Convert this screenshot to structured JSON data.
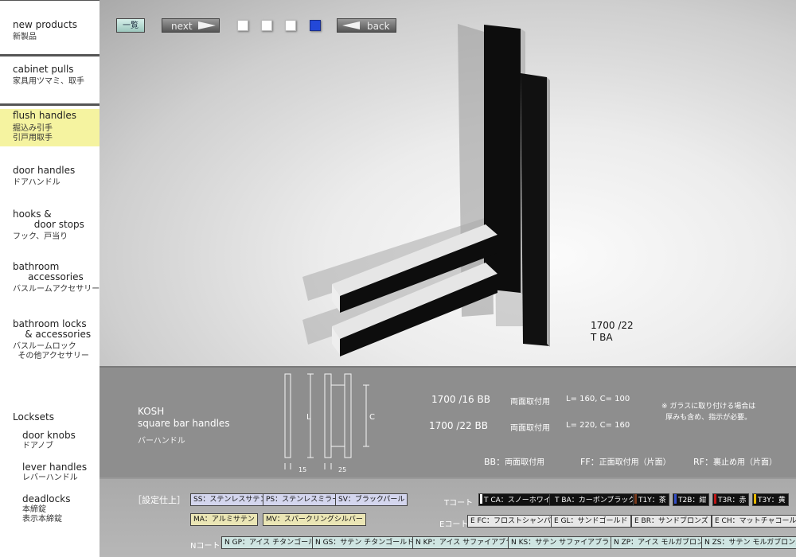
{
  "nav": [
    {
      "en": "new products",
      "jp": "新製品"
    },
    {
      "en": "cabinet pulls",
      "jp": "家具用ツマミ、取手"
    },
    {
      "en": "flush handles",
      "jp": "掘込み引手\n引戸用取手"
    },
    {
      "en": "door handles",
      "jp": "ドアハンドル"
    },
    {
      "en": "hooks &\n       door stops",
      "jp": "フック、戸当り"
    },
    {
      "en": "bathroom\n     accessories",
      "jp": "バスルームアクセサリー"
    },
    {
      "en": "bathroom locks\n    & accessories",
      "jp": "バスルームロック\n  その他アクセサリー"
    },
    {
      "en": "Locksets",
      "jp": ""
    }
  ],
  "locksets": [
    {
      "en": "door knobs",
      "jp": "ドアノブ"
    },
    {
      "en": "lever handles",
      "jp": "レバーハンドル"
    },
    {
      "en": "deadlocks",
      "jp": "本締錠\n表示本締錠"
    }
  ],
  "toolbar": {
    "list": "一覧",
    "next": "next",
    "back": "back",
    "active_page": 4,
    "pages": 4
  },
  "caption": {
    "line1": "1700 /22",
    "line2": "T BA"
  },
  "product": {
    "name": "KOSH",
    "subtitle": "square bar handles",
    "jp": "バーハンドル"
  },
  "dims": {
    "L": "L",
    "C": "C",
    "w15": "15",
    "w25": "25"
  },
  "models": [
    {
      "code": "1700 /16 BB",
      "mount": "両面取付用",
      "size": "L= 160,   C= 100"
    },
    {
      "code": "1700 /22 BB",
      "mount": "両面取付用",
      "size": "L= 220,   C= 160"
    }
  ],
  "glass_note": "※ ガラスに取り付ける場合は\n厚みも含め、指示が必要。",
  "legend": [
    {
      "code": "BB",
      "desc": "両面取付用"
    },
    {
      "code": "FF",
      "desc": "正面取付用（片面）"
    },
    {
      "code": "RF",
      "desc": "裏止め用（片面）"
    }
  ],
  "finish_title": "［設定仕上］",
  "finishes_left": [
    {
      "label": "SS：ステンレスサテン",
      "style": "c-blue"
    },
    {
      "label": "PS：ステンレスミラー",
      "style": "c-blue"
    },
    {
      "label": "SV：ブラックパール",
      "style": "c-blue"
    },
    {
      "label": "MA：アルミサテン",
      "style": "c-yel"
    },
    {
      "label": "MV：スパークリングシルバー",
      "style": "c-yel"
    }
  ],
  "rows": {
    "t": "Tコート",
    "e": "Eコート",
    "n": "Nコート"
  },
  "tcoat": [
    {
      "label": "T CA：スノーホワイト",
      "color": "#ffffff"
    },
    {
      "label": "T BA：カーボンブラック",
      "color": "#111111"
    },
    {
      "label": "T1Y：茶",
      "color": "#7a3b1e"
    },
    {
      "label": "T2B：紺",
      "color": "#1e2f7a"
    },
    {
      "label": "T3R：赤",
      "color": "#c01616"
    },
    {
      "label": "T3Y：黄",
      "color": "#e6b800"
    }
  ],
  "ecoat": [
    {
      "label": "E FC：フロストシャンパン"
    },
    {
      "label": "E GL：サンドゴールド"
    },
    {
      "label": "E BR：サンドブロンズ"
    },
    {
      "label": "E CH：マットチャコール"
    }
  ],
  "ncoat": [
    {
      "label": "N GP：アイス チタンゴールド"
    },
    {
      "label": "N GS：サテン チタンゴールド"
    },
    {
      "label": "N KP：アイス サファイアブラック"
    },
    {
      "label": "N KS：サテン サファイアブラック"
    },
    {
      "label": "N ZP：アイス モルガブロンズ"
    },
    {
      "label": "N ZS：サテン モルガブロンズ"
    }
  ]
}
